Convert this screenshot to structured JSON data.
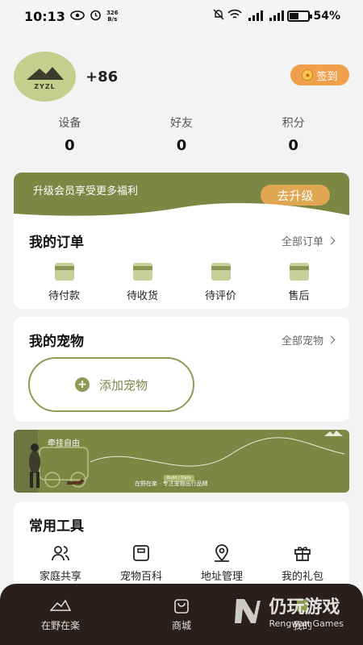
{
  "status_bar": {
    "time": "10:13",
    "net_speed_value": "326",
    "net_speed_unit": "B/s",
    "battery": "54%",
    "battery_level": 0.54
  },
  "profile": {
    "avatar_text": "ZYZL",
    "phone": "+86",
    "signin_label": "签到"
  },
  "stats": [
    {
      "label": "设备",
      "value": "0"
    },
    {
      "label": "好友",
      "value": "0"
    },
    {
      "label": "积分",
      "value": "0"
    }
  ],
  "member_banner": {
    "text": "升级会员享受更多福利",
    "button": "去升级"
  },
  "orders": {
    "title": "我的订单",
    "more": "全部订单",
    "items": [
      {
        "label": "待付款",
        "icon": "wallet-icon"
      },
      {
        "label": "待收货",
        "icon": "truck-icon"
      },
      {
        "label": "待评价",
        "icon": "review-icon"
      },
      {
        "label": "售后",
        "icon": "after-sales-icon"
      }
    ]
  },
  "pets": {
    "title": "我的宠物",
    "more": "全部宠物",
    "add_label": "添加宠物"
  },
  "ad_banner": {
    "slogan": "牵挂自由",
    "brand": "在野在楽 · 专注宠物出行品牌",
    "tag": "Build | Daily"
  },
  "tools": {
    "title": "常用工具",
    "items": [
      {
        "label": "家庭共享",
        "icon": "family-share-icon"
      },
      {
        "label": "宠物百科",
        "icon": "encyclopedia-icon"
      },
      {
        "label": "地址管理",
        "icon": "location-icon"
      },
      {
        "label": "我的礼包",
        "icon": "gift-icon"
      }
    ]
  },
  "tabbar": {
    "items": [
      {
        "label": "在野在楽",
        "icon": "home-logo-icon"
      },
      {
        "label": "商城",
        "icon": "shopping-bag-icon"
      },
      {
        "label": "我的",
        "icon": "profile-icon"
      }
    ]
  },
  "watermark": {
    "cn": "仍玩游戏",
    "en": "Rengwan Games"
  },
  "colors": {
    "olive": "#7c8744",
    "signin": "#f0a04a",
    "upgrade": "#e0a651",
    "tabbar": "#2a1f1c"
  }
}
